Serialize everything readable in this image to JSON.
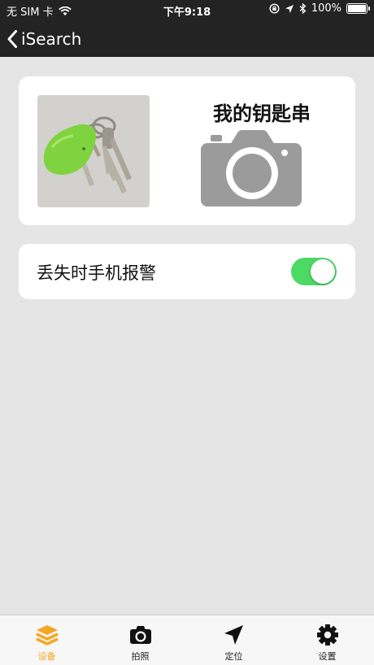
{
  "status_bar": {
    "carrier": "无 SIM 卡",
    "time": "下午9:18",
    "battery": "100%"
  },
  "nav": {
    "back_title": "iSearch"
  },
  "device_card": {
    "name": "我的钥匙串"
  },
  "alarm": {
    "label": "丢失时手机报警",
    "enabled": true
  },
  "tabs": [
    {
      "label": "设备",
      "icon": "layers-icon",
      "active": true
    },
    {
      "label": "拍照",
      "icon": "camera-icon",
      "active": false
    },
    {
      "label": "定位",
      "icon": "location-arrow-icon",
      "active": false
    },
    {
      "label": "设置",
      "icon": "gear-icon",
      "active": false
    }
  ],
  "colors": {
    "accent": "#f5a623",
    "toggle_on": "#4cd964",
    "nav_bg": "#232323",
    "page_bg": "#e5e5e5"
  }
}
